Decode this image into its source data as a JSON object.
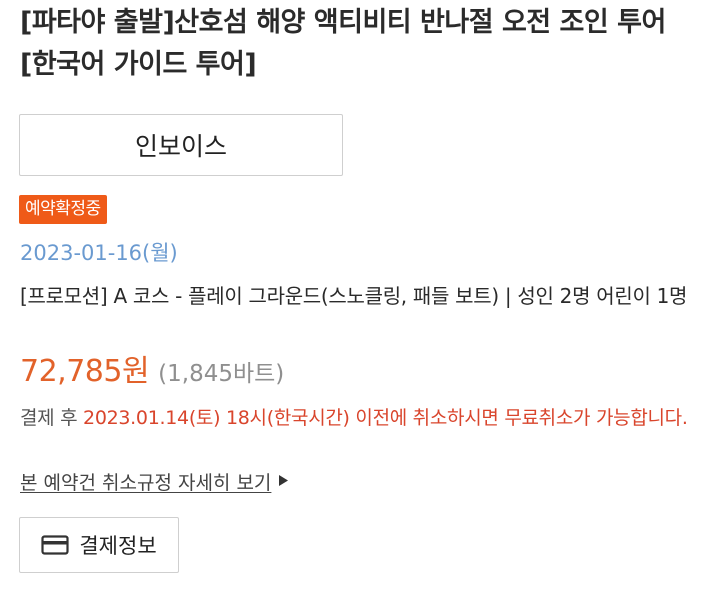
{
  "product": {
    "title": "[파타야 출발]산호섬 해양 액티비티 반나절 오전 조인 투어 [한국어 가이드 투어]"
  },
  "invoice_button": {
    "label": "인보이스"
  },
  "status": {
    "label": "예약확정중",
    "color": "#ef5a18"
  },
  "booking": {
    "date": "2023-01-16(월)",
    "option": "[프로모션] A 코스 - 플레이 그라운드(스노클링, 패들 보트) | 성인 2명 어린이 1명"
  },
  "price": {
    "amount": "72,785원",
    "local": "(1,845바트)",
    "color": "#e2622a"
  },
  "cancellation": {
    "prefix": "결제 후 ",
    "highlight": "2023.01.14(토) 18시(한국시간) 이전에 취소하시면 무료취소가 가능합니다.",
    "highlight_color": "#d9452c"
  },
  "policy_link": {
    "label": "본 예약건 취소규정 자세히 보기",
    "icon": "triangle-right-icon"
  },
  "payment_button": {
    "label": "결제정보",
    "icon": "credit-card-icon"
  }
}
